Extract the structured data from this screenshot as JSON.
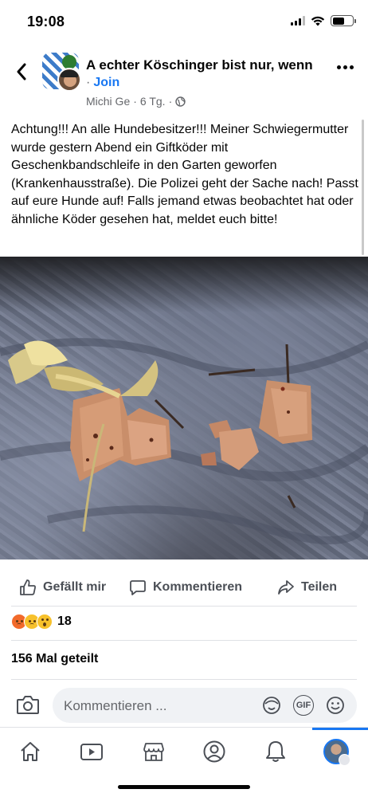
{
  "status_bar": {
    "time": "19:08"
  },
  "header": {
    "group_name": "A echter Köschinger bist nur, wenn",
    "join_label": "Join",
    "author": "Michi Ge",
    "age": "6 Tg.",
    "privacy_icon": "globe-icon"
  },
  "post": {
    "text": "Achtung!!! An alle Hundebesitzer!!! Meiner Schwiegermutter wurde gestern Abend ein Giftköder mit Geschenkbandschleife in den Garten geworfen (Krankenhausstraße). Die Polizei geht der Sache nach! Passt auf eure Hunde auf! Falls jemand etwas beobachtet hat oder ähnliche Köder gesehen hat, meldet euch bitte!"
  },
  "actions": {
    "like": "Gefällt mir",
    "comment": "Kommentieren",
    "share": "Teilen"
  },
  "reactions": {
    "types": [
      "angry",
      "sad",
      "wow"
    ],
    "count": "18"
  },
  "shares_text": "156 Mal geteilt",
  "comment_bar": {
    "placeholder": "Kommentieren ...",
    "gif_label": "GIF"
  },
  "tabs": [
    "home",
    "video",
    "marketplace",
    "profile",
    "notifications",
    "menu"
  ],
  "colors": {
    "accent": "#1877f2",
    "muted": "#65676b"
  }
}
